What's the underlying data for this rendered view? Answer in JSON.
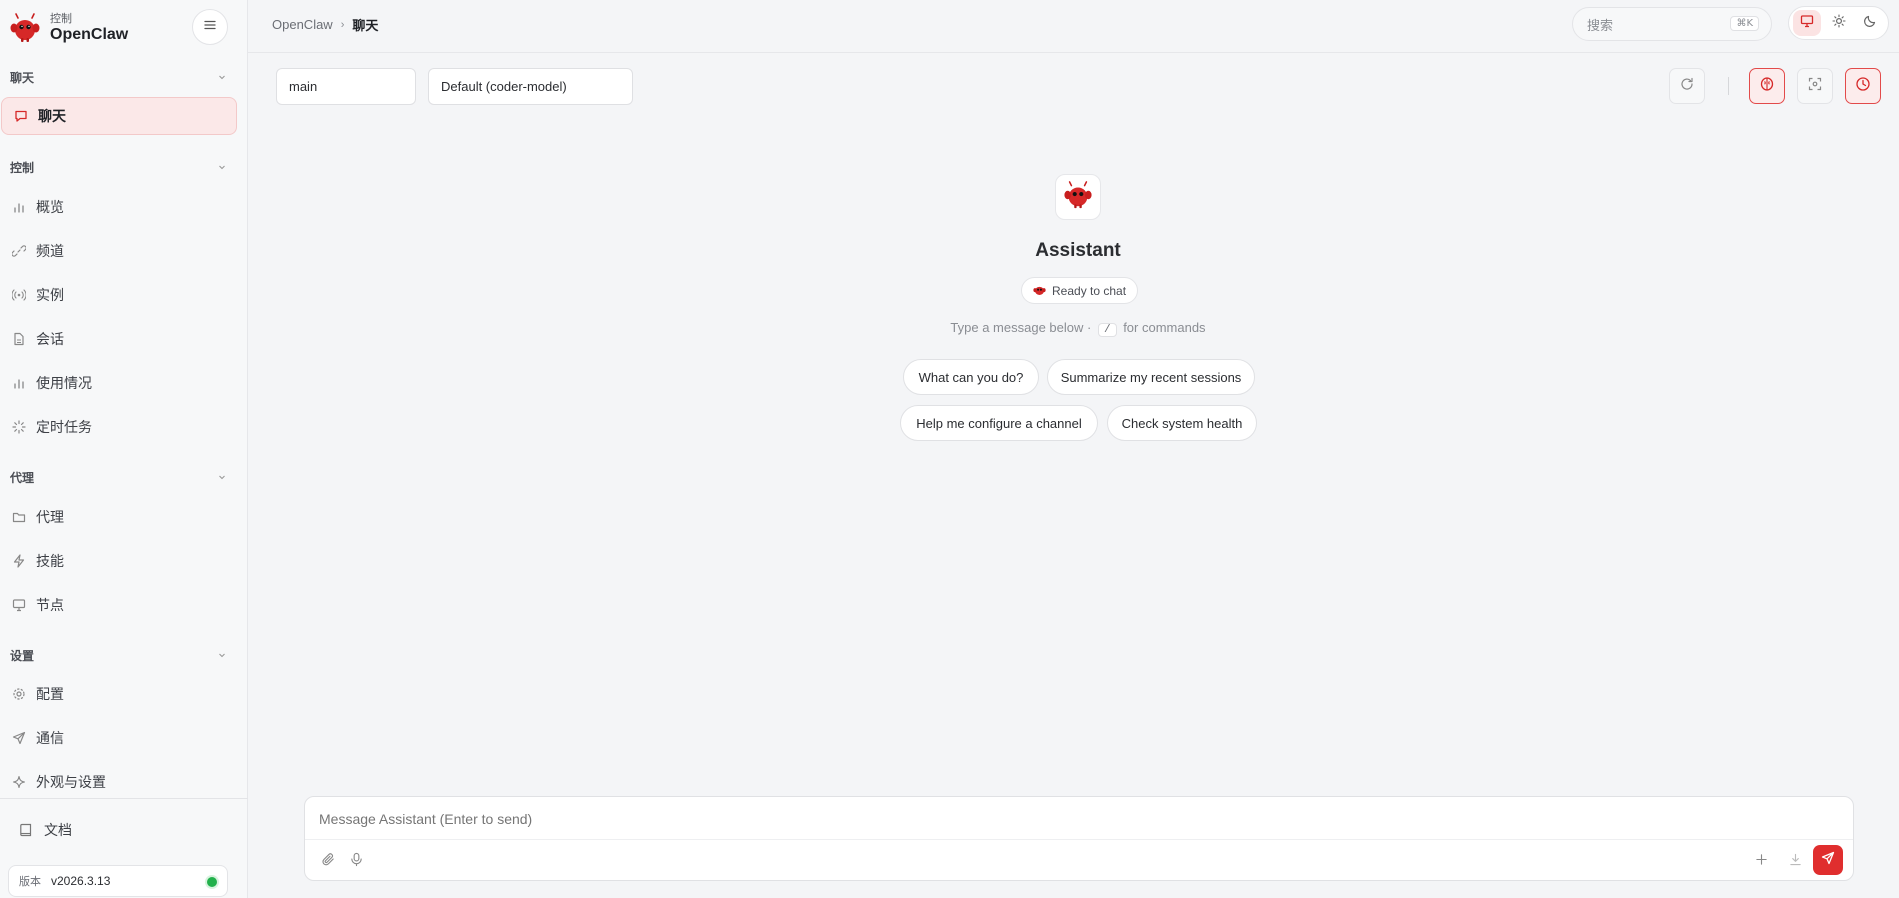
{
  "brand": {
    "sub": "控制",
    "name": "OpenClaw",
    "logo_icon": "lobster-mascot-icon"
  },
  "sidebar": {
    "sections": [
      {
        "title": "聊天",
        "items": [
          {
            "label": "聊天",
            "icon": "message-icon",
            "active": true
          }
        ]
      },
      {
        "title": "控制",
        "items": [
          {
            "label": "概览",
            "icon": "bar-chart-icon"
          },
          {
            "label": "频道",
            "icon": "link-icon"
          },
          {
            "label": "实例",
            "icon": "broadcast-icon"
          },
          {
            "label": "会话",
            "icon": "file-icon"
          },
          {
            "label": "使用情况",
            "icon": "bar-chart-icon"
          },
          {
            "label": "定时任务",
            "icon": "loader-icon"
          }
        ]
      },
      {
        "title": "代理",
        "items": [
          {
            "label": "代理",
            "icon": "folder-icon"
          },
          {
            "label": "技能",
            "icon": "zap-icon"
          },
          {
            "label": "节点",
            "icon": "monitor-icon"
          }
        ]
      },
      {
        "title": "设置",
        "items": [
          {
            "label": "配置",
            "icon": "gear-icon"
          },
          {
            "label": "通信",
            "icon": "send-icon"
          },
          {
            "label": "外观与设置",
            "icon": "sparkle-icon"
          }
        ]
      }
    ],
    "docs_label": "文档",
    "version": {
      "label": "版本",
      "value": "v2026.3.13",
      "status_color": "#22b14c"
    }
  },
  "topbar": {
    "breadcrumb": [
      "OpenClaw",
      "聊天"
    ],
    "search": {
      "placeholder": "搜索",
      "shortcut": "⌘K"
    }
  },
  "toolbar": {
    "session_select": "main",
    "model_select": "Default (coder-model)"
  },
  "welcome": {
    "title": "Assistant",
    "status": "Ready to chat",
    "hint_before": "Type a message below ·",
    "hint_key": "/",
    "hint_after": "for commands",
    "suggestions": [
      "What can you do?",
      "Summarize my recent sessions",
      "Help me configure a channel",
      "Check system health"
    ]
  },
  "composer": {
    "placeholder": "Message Assistant (Enter to send)"
  },
  "colors": {
    "accent": "#e02e2e",
    "accent_soft": "#fbe8e8",
    "online": "#22b14c"
  }
}
